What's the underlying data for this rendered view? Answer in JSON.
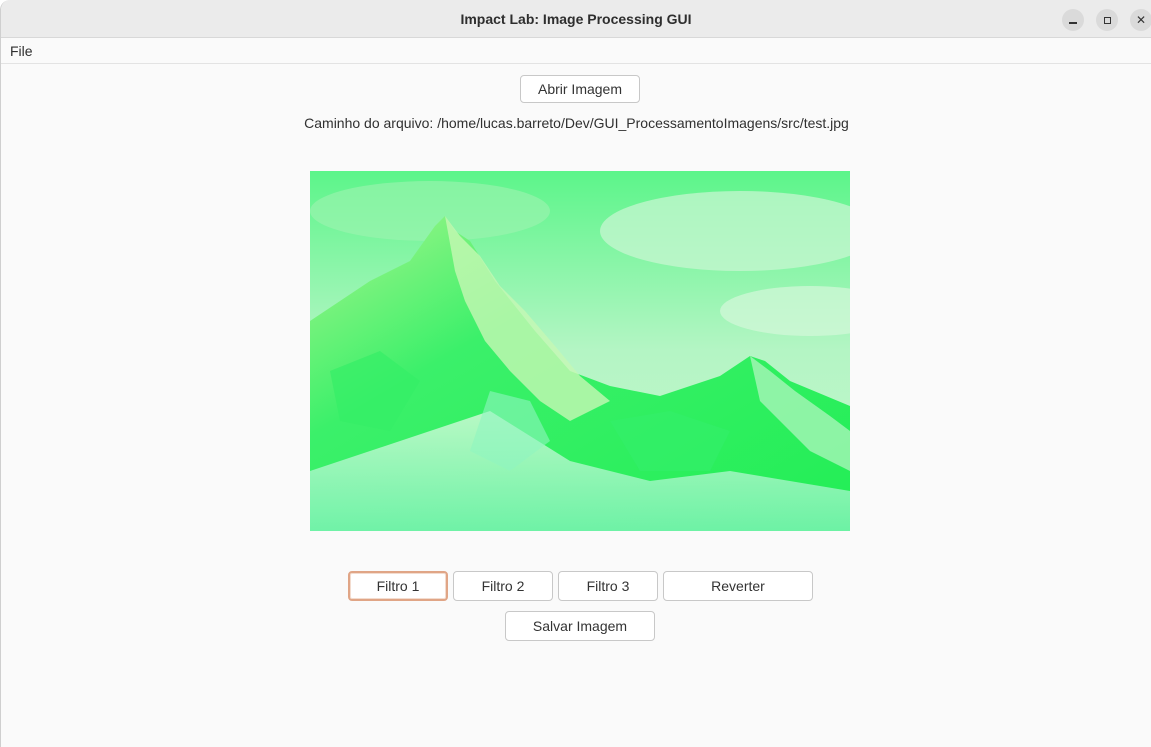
{
  "window": {
    "title": "Impact Lab: Image Processing GUI",
    "controls": {
      "minimize": "minimize-icon",
      "maximize": "maximize-icon",
      "close": "close-icon"
    }
  },
  "menubar": {
    "file_label": "File"
  },
  "main": {
    "open_button_label": "Abrir Imagem",
    "path_text": "Caminho do arquivo: /home/lucas.barreto/Dev/GUI_ProcessamentoImagens/src/test.jpg",
    "filter_buttons": [
      "Filtro 1",
      "Filtro 2",
      "Filtro 3",
      "Reverter"
    ],
    "save_button_label": "Salvar Imagem"
  },
  "colors": {
    "focus_ring": "#e0a586",
    "image_tint": "#33ff66"
  }
}
